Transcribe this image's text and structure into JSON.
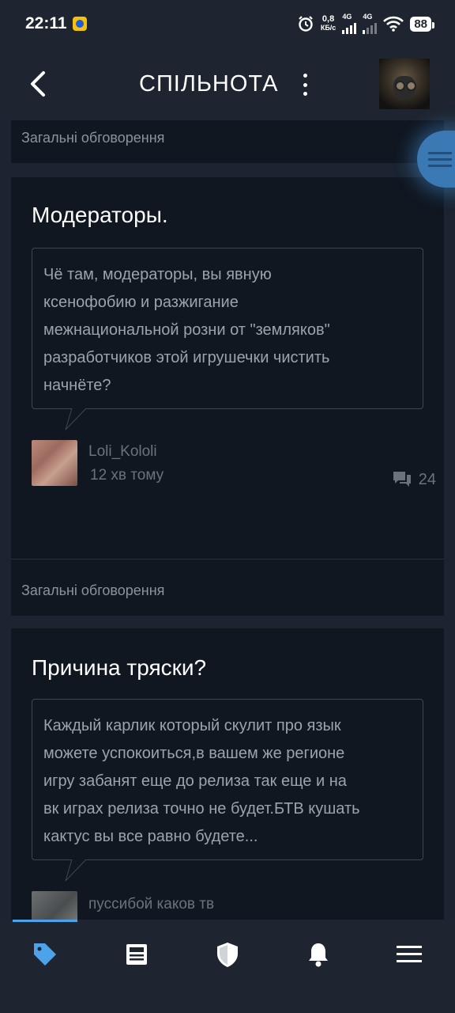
{
  "status_bar": {
    "time": "22:11",
    "net_speed_value": "0,8",
    "net_speed_unit": "КБ/с",
    "net1": "4G",
    "net2": "4G",
    "battery": "88"
  },
  "header": {
    "back_icon": "chevron-left-icon",
    "title": "СПІЛЬНОТА",
    "menu_icon": "kebab-menu-icon"
  },
  "posts": [
    {
      "category": "Загальні обговорення",
      "title": "Модераторы.",
      "body_lines": [
        "Чё там, модераторы, вы явную",
        "ксенофобию и разжигание",
        "межнациональной розни от \"земляков\"",
        "разработчиков этой игрушечки чистить",
        "начнёте?"
      ],
      "author": "Loli_Kololi",
      "time": "12 хв тому",
      "comments": "24"
    },
    {
      "category": "Загальні обговорення",
      "title": "Причина тряски?",
      "body_lines": [
        "Каждый карлик который скулит про язык",
        "можете успокоиться,в вашем же регионе",
        "игру забанят еще до релиза так еще и на",
        "вк играх релиза точно не будет.БТВ кушать",
        "кактус вы все равно будете..."
      ],
      "author": "пуссибой каков тв"
    }
  ],
  "bottom_nav": [
    {
      "icon": "tag-icon",
      "active": true
    },
    {
      "icon": "news-icon",
      "active": false
    },
    {
      "icon": "shield-icon",
      "active": false
    },
    {
      "icon": "bell-icon",
      "active": false
    },
    {
      "icon": "menu-icon",
      "active": false
    }
  ],
  "colors": {
    "accent": "#4ca3ea",
    "background": "#1b2430",
    "card": "#101721",
    "muted_text": "#6a737c"
  }
}
